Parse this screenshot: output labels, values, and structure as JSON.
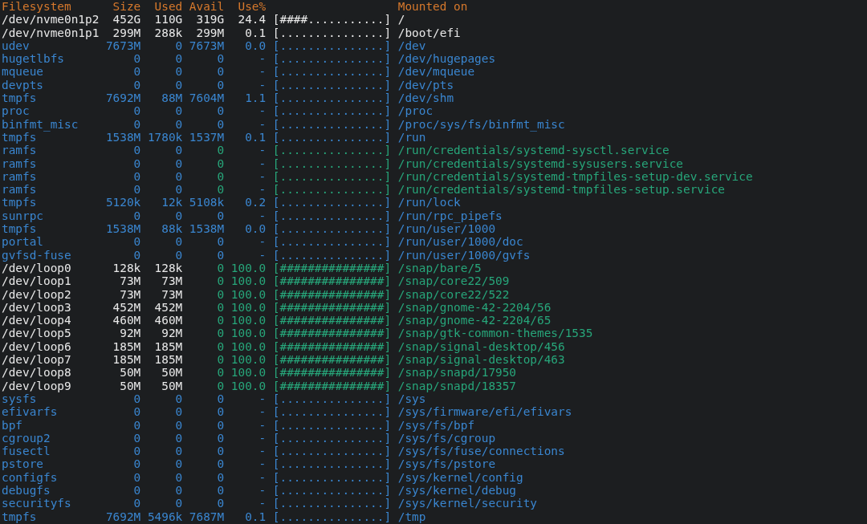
{
  "header": {
    "filesystem": "Filesystem",
    "size": "Size",
    "used": "Used",
    "avail": "Avail",
    "use": "Use%",
    "mounted_on": "Mounted on"
  },
  "rows": [
    {
      "kind": "disk",
      "filesystem": "/dev/nvme0n1p2",
      "size": "452G",
      "used": "110G",
      "avail": "319G",
      "use": "24.4",
      "bar": "[####...........]",
      "mounted_on": "/"
    },
    {
      "kind": "disk",
      "filesystem": "/dev/nvme0n1p1",
      "size": "299M",
      "used": "288k",
      "avail": "299M",
      "use": "0.1",
      "bar": "[...............]",
      "mounted_on": "/boot/efi"
    },
    {
      "kind": "pseudo",
      "filesystem": "udev",
      "size": "7673M",
      "used": "0",
      "avail": "7673M",
      "use": "0.0",
      "bar": "[...............]",
      "mounted_on": "/dev"
    },
    {
      "kind": "pseudo",
      "filesystem": "hugetlbfs",
      "size": "0",
      "used": "0",
      "avail": "0",
      "use": "-",
      "bar": "[...............]",
      "mounted_on": "/dev/hugepages"
    },
    {
      "kind": "pseudo",
      "filesystem": "mqueue",
      "size": "0",
      "used": "0",
      "avail": "0",
      "use": "-",
      "bar": "[...............]",
      "mounted_on": "/dev/mqueue"
    },
    {
      "kind": "pseudo",
      "filesystem": "devpts",
      "size": "0",
      "used": "0",
      "avail": "0",
      "use": "-",
      "bar": "[...............]",
      "mounted_on": "/dev/pts"
    },
    {
      "kind": "pseudo",
      "filesystem": "tmpfs",
      "size": "7692M",
      "used": "88M",
      "avail": "7604M",
      "use": "1.1",
      "bar": "[...............]",
      "mounted_on": "/dev/shm"
    },
    {
      "kind": "pseudo",
      "filesystem": "proc",
      "size": "0",
      "used": "0",
      "avail": "0",
      "use": "-",
      "bar": "[...............]",
      "mounted_on": "/proc"
    },
    {
      "kind": "pseudo",
      "filesystem": "binfmt_misc",
      "size": "0",
      "used": "0",
      "avail": "0",
      "use": "-",
      "bar": "[...............]",
      "mounted_on": "/proc/sys/fs/binfmt_misc"
    },
    {
      "kind": "pseudo",
      "filesystem": "tmpfs",
      "size": "1538M",
      "used": "1780k",
      "avail": "1537M",
      "use": "0.1",
      "bar": "[...............]",
      "mounted_on": "/run"
    },
    {
      "kind": "ramfs",
      "filesystem": "ramfs",
      "size": "0",
      "used": "0",
      "avail": "0",
      "use": "-",
      "bar": "[...............]",
      "mounted_on": "/run/credentials/systemd-sysctl.service"
    },
    {
      "kind": "ramfs",
      "filesystem": "ramfs",
      "size": "0",
      "used": "0",
      "avail": "0",
      "use": "-",
      "bar": "[...............]",
      "mounted_on": "/run/credentials/systemd-sysusers.service"
    },
    {
      "kind": "ramfs",
      "filesystem": "ramfs",
      "size": "0",
      "used": "0",
      "avail": "0",
      "use": "-",
      "bar": "[...............]",
      "mounted_on": "/run/credentials/systemd-tmpfiles-setup-dev.service"
    },
    {
      "kind": "ramfs",
      "filesystem": "ramfs",
      "size": "0",
      "used": "0",
      "avail": "0",
      "use": "-",
      "bar": "[...............]",
      "mounted_on": "/run/credentials/systemd-tmpfiles-setup.service"
    },
    {
      "kind": "pseudo",
      "filesystem": "tmpfs",
      "size": "5120k",
      "used": "12k",
      "avail": "5108k",
      "use": "0.2",
      "bar": "[...............]",
      "mounted_on": "/run/lock"
    },
    {
      "kind": "pseudo",
      "filesystem": "sunrpc",
      "size": "0",
      "used": "0",
      "avail": "0",
      "use": "-",
      "bar": "[...............]",
      "mounted_on": "/run/rpc_pipefs"
    },
    {
      "kind": "pseudo",
      "filesystem": "tmpfs",
      "size": "1538M",
      "used": "88k",
      "avail": "1538M",
      "use": "0.0",
      "bar": "[...............]",
      "mounted_on": "/run/user/1000"
    },
    {
      "kind": "pseudo",
      "filesystem": "portal",
      "size": "0",
      "used": "0",
      "avail": "0",
      "use": "-",
      "bar": "[...............]",
      "mounted_on": "/run/user/1000/doc"
    },
    {
      "kind": "pseudo",
      "filesystem": "gvfsd-fuse",
      "size": "0",
      "used": "0",
      "avail": "0",
      "use": "-",
      "bar": "[...............]",
      "mounted_on": "/run/user/1000/gvfs"
    },
    {
      "kind": "loop",
      "filesystem": "/dev/loop0",
      "size": "128k",
      "used": "128k",
      "avail": "0",
      "use": "100.0",
      "bar": "[###############]",
      "mounted_on": "/snap/bare/5"
    },
    {
      "kind": "loop",
      "filesystem": "/dev/loop1",
      "size": "73M",
      "used": "73M",
      "avail": "0",
      "use": "100.0",
      "bar": "[###############]",
      "mounted_on": "/snap/core22/509"
    },
    {
      "kind": "loop",
      "filesystem": "/dev/loop2",
      "size": "73M",
      "used": "73M",
      "avail": "0",
      "use": "100.0",
      "bar": "[###############]",
      "mounted_on": "/snap/core22/522"
    },
    {
      "kind": "loop",
      "filesystem": "/dev/loop3",
      "size": "452M",
      "used": "452M",
      "avail": "0",
      "use": "100.0",
      "bar": "[###############]",
      "mounted_on": "/snap/gnome-42-2204/56"
    },
    {
      "kind": "loop",
      "filesystem": "/dev/loop4",
      "size": "460M",
      "used": "460M",
      "avail": "0",
      "use": "100.0",
      "bar": "[###############]",
      "mounted_on": "/snap/gnome-42-2204/65"
    },
    {
      "kind": "loop",
      "filesystem": "/dev/loop5",
      "size": "92M",
      "used": "92M",
      "avail": "0",
      "use": "100.0",
      "bar": "[###############]",
      "mounted_on": "/snap/gtk-common-themes/1535"
    },
    {
      "kind": "loop",
      "filesystem": "/dev/loop6",
      "size": "185M",
      "used": "185M",
      "avail": "0",
      "use": "100.0",
      "bar": "[###############]",
      "mounted_on": "/snap/signal-desktop/456"
    },
    {
      "kind": "loop",
      "filesystem": "/dev/loop7",
      "size": "185M",
      "used": "185M",
      "avail": "0",
      "use": "100.0",
      "bar": "[###############]",
      "mounted_on": "/snap/signal-desktop/463"
    },
    {
      "kind": "loop",
      "filesystem": "/dev/loop8",
      "size": "50M",
      "used": "50M",
      "avail": "0",
      "use": "100.0",
      "bar": "[###############]",
      "mounted_on": "/snap/snapd/17950"
    },
    {
      "kind": "loop",
      "filesystem": "/dev/loop9",
      "size": "50M",
      "used": "50M",
      "avail": "0",
      "use": "100.0",
      "bar": "[###############]",
      "mounted_on": "/snap/snapd/18357"
    },
    {
      "kind": "pseudo",
      "filesystem": "sysfs",
      "size": "0",
      "used": "0",
      "avail": "0",
      "use": "-",
      "bar": "[...............]",
      "mounted_on": "/sys"
    },
    {
      "kind": "pseudo",
      "filesystem": "efivarfs",
      "size": "0",
      "used": "0",
      "avail": "0",
      "use": "-",
      "bar": "[...............]",
      "mounted_on": "/sys/firmware/efi/efivars"
    },
    {
      "kind": "pseudo",
      "filesystem": "bpf",
      "size": "0",
      "used": "0",
      "avail": "0",
      "use": "-",
      "bar": "[...............]",
      "mounted_on": "/sys/fs/bpf"
    },
    {
      "kind": "pseudo",
      "filesystem": "cgroup2",
      "size": "0",
      "used": "0",
      "avail": "0",
      "use": "-",
      "bar": "[...............]",
      "mounted_on": "/sys/fs/cgroup"
    },
    {
      "kind": "pseudo",
      "filesystem": "fusectl",
      "size": "0",
      "used": "0",
      "avail": "0",
      "use": "-",
      "bar": "[...............]",
      "mounted_on": "/sys/fs/fuse/connections"
    },
    {
      "kind": "pseudo",
      "filesystem": "pstore",
      "size": "0",
      "used": "0",
      "avail": "0",
      "use": "-",
      "bar": "[...............]",
      "mounted_on": "/sys/fs/pstore"
    },
    {
      "kind": "pseudo",
      "filesystem": "configfs",
      "size": "0",
      "used": "0",
      "avail": "0",
      "use": "-",
      "bar": "[...............]",
      "mounted_on": "/sys/kernel/config"
    },
    {
      "kind": "pseudo",
      "filesystem": "debugfs",
      "size": "0",
      "used": "0",
      "avail": "0",
      "use": "-",
      "bar": "[...............]",
      "mounted_on": "/sys/kernel/debug"
    },
    {
      "kind": "pseudo",
      "filesystem": "securityfs",
      "size": "0",
      "used": "0",
      "avail": "0",
      "use": "-",
      "bar": "[...............]",
      "mounted_on": "/sys/kernel/security"
    },
    {
      "kind": "pseudo",
      "filesystem": "tmpfs",
      "size": "7692M",
      "used": "5496k",
      "avail": "7687M",
      "use": "0.1",
      "bar": "[...............]",
      "mounted_on": "/tmp"
    }
  ]
}
